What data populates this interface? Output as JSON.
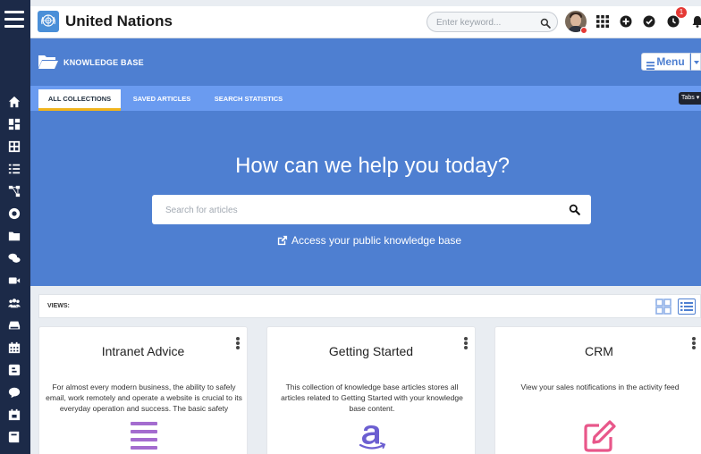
{
  "app": {
    "title": "United Nations"
  },
  "header": {
    "search_placeholder": "Enter keyword...",
    "notification_count": "1",
    "icons": [
      "grid-apps-icon",
      "plus-circle-icon",
      "check-circle-icon",
      "clock-icon",
      "bell-icon"
    ]
  },
  "sidebar": {
    "icons": [
      "home-icon",
      "dashboard-icon",
      "modules-icon",
      "tasks-icon",
      "workflow-icon",
      "support-icon",
      "folder-icon",
      "chat-icon",
      "video-icon",
      "users-icon",
      "storage-icon",
      "calendar-icon",
      "blog-icon",
      "comments-icon",
      "events-icon",
      "book-icon"
    ]
  },
  "module": {
    "title": "KNOWLEDGE BASE",
    "menu_label": "Menu"
  },
  "tabs": {
    "items": [
      {
        "label": "ALL COLLECTIONS"
      },
      {
        "label": "SAVED ARTICLES"
      },
      {
        "label": "SEARCH STATISTICS"
      }
    ],
    "dropdown_label": "Tabs"
  },
  "hero": {
    "title": "How can we help you today?",
    "search_placeholder": "Search for articles",
    "public_link": "Access your public knowledge base"
  },
  "views": {
    "label": "VIEWS:"
  },
  "collections": [
    {
      "title": "Intranet Advice",
      "description": "For almost every modern business, the ability to safely email, work remotely and operate a website is crucial to its everyday operation and success. The basic safety",
      "icon": "list-icon",
      "icon_color": "#a46ccf"
    },
    {
      "title": "Getting Started",
      "description": "This collection of knowledge base articles stores all articles related to Getting Started with your knowledge base content.",
      "icon": "amazon-icon",
      "icon_color": "#6c5fd1"
    },
    {
      "title": "CRM",
      "description": "View your sales notifications in the activity feed",
      "icon": "edit-icon",
      "icon_color": "#e8578a"
    }
  ],
  "colors": {
    "brand_blue": "#4e7fd1",
    "tab_blue": "#6a9bf0",
    "rail_navy": "#1c2a48",
    "active_tab_accent": "#f0b31c",
    "alert_red": "#e53935"
  }
}
